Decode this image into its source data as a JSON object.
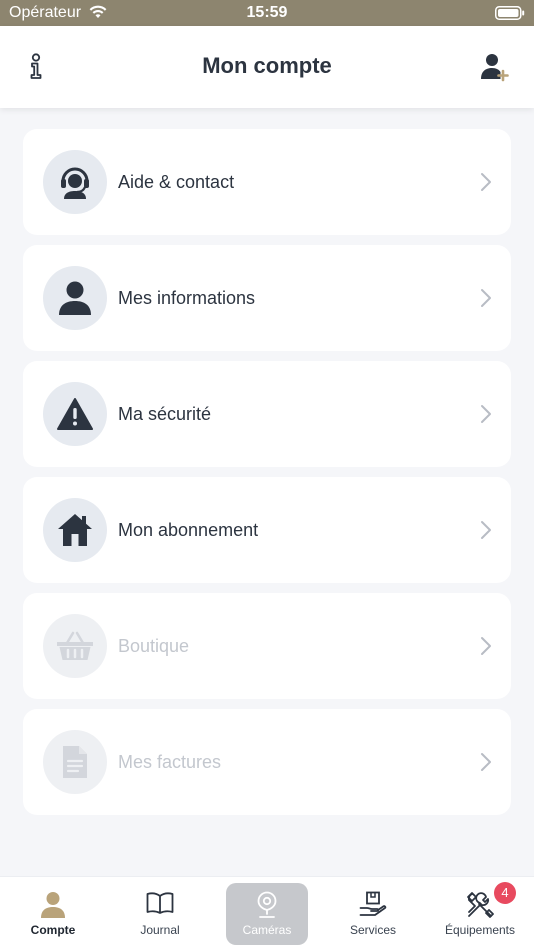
{
  "status_bar": {
    "carrier": "Opérateur",
    "time": "15:59"
  },
  "header": {
    "title": "Mon compte"
  },
  "menu": {
    "items": [
      {
        "label": "Aide & contact",
        "icon": "support-agent-icon",
        "enabled": true
      },
      {
        "label": "Mes informations",
        "icon": "user-icon",
        "enabled": true
      },
      {
        "label": "Ma sécurité",
        "icon": "warning-icon",
        "enabled": true
      },
      {
        "label": "Mon abonnement",
        "icon": "home-icon",
        "enabled": true
      },
      {
        "label": "Boutique",
        "icon": "basket-icon",
        "enabled": false
      },
      {
        "label": "Mes factures",
        "icon": "document-icon",
        "enabled": false
      }
    ]
  },
  "tabs": [
    {
      "label": "Compte",
      "icon": "user-icon",
      "active": true
    },
    {
      "label": "Journal",
      "icon": "book-icon",
      "active": false
    },
    {
      "label": "Caméras",
      "icon": "camera-icon",
      "active": false
    },
    {
      "label": "Services",
      "icon": "services-icon",
      "active": false
    },
    {
      "label": "Équipements",
      "icon": "tools-icon",
      "active": false
    }
  ],
  "equipements_badge": "4",
  "colors": {
    "status_bar": "#8d856f",
    "accent_gold": "#b9a37a",
    "icon_dark": "#2c3440",
    "badge": "#e84a5f",
    "disabled_text": "#c3c7ce"
  }
}
